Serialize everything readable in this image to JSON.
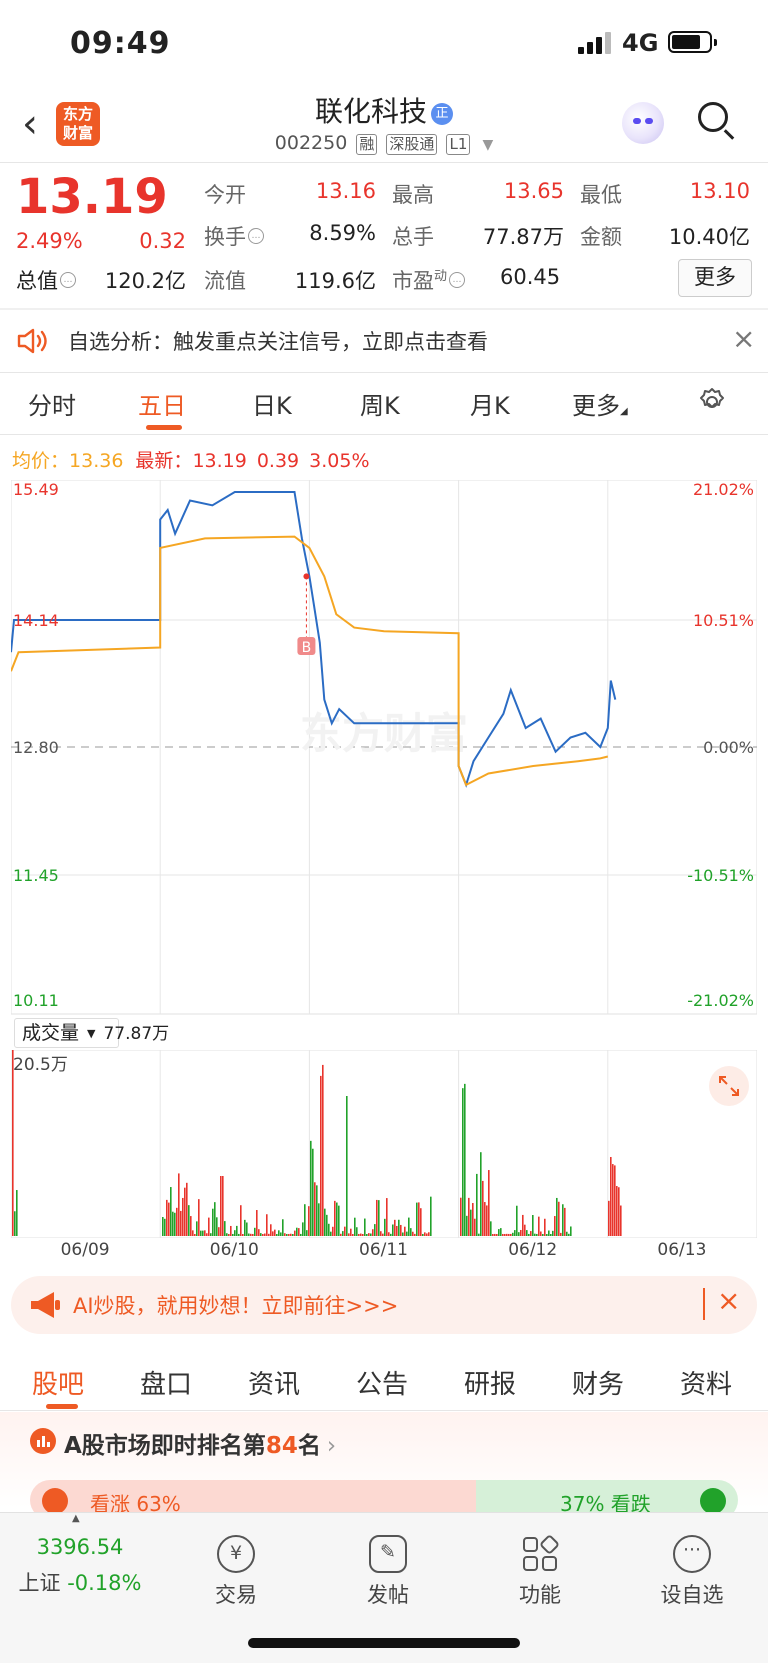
{
  "status": {
    "time": "09:49",
    "network": "4G"
  },
  "header": {
    "logo_line1": "东方",
    "logo_line2": "财富",
    "name": "联化科技",
    "badge": "正",
    "code": "002250",
    "tags": [
      "融",
      "深股通",
      "L1"
    ]
  },
  "quote": {
    "price": "13.19",
    "change_pct": "2.49%",
    "change": "0.32",
    "total_mv_label": "总值",
    "total_mv": "120.2亿",
    "fields": [
      {
        "label": "今开",
        "value": "13.16",
        "color": "#e8342c"
      },
      {
        "label": "最高",
        "value": "13.65",
        "color": "#e8342c"
      },
      {
        "label": "最低",
        "value": "13.10",
        "color": "#e8342c"
      },
      {
        "label": "换手",
        "value": "8.59%",
        "color": "#222222"
      },
      {
        "label": "总手",
        "value": "77.87万",
        "color": "#222222"
      },
      {
        "label": "金额",
        "value": "10.40亿",
        "color": "#222222"
      },
      {
        "label": "流值",
        "value": "119.6亿",
        "color": "#222222"
      },
      {
        "label": "市盈",
        "label_sup": "动",
        "value": "60.45",
        "color": "#222222"
      }
    ],
    "more": "更多"
  },
  "notice": {
    "text": "自选分析：触发重点关注信号，立即点击查看"
  },
  "tabs": [
    {
      "label": "分时",
      "active": false
    },
    {
      "label": "五日",
      "active": true
    },
    {
      "label": "日K",
      "active": false
    },
    {
      "label": "周K",
      "active": false
    },
    {
      "label": "月K",
      "active": false
    },
    {
      "label": "更多",
      "active": false
    }
  ],
  "legend": {
    "avg_label": "均价：",
    "avg_value": "13.36",
    "last_label": "最新：",
    "last_value": "13.19",
    "last_change": "0.39",
    "last_pct": "3.05%"
  },
  "chart_data": {
    "type": "line",
    "title": "",
    "x_dates": [
      "06/09",
      "06/10",
      "06/11",
      "06/12",
      "06/13"
    ],
    "y_ticks_left": [
      "15.49",
      "14.14",
      "12.80",
      "11.45",
      "10.11"
    ],
    "y_ticks_right": [
      "21.02%",
      "10.51%",
      "0.00%",
      "-10.51%",
      "-21.02%"
    ],
    "ylim": [
      10.11,
      15.49
    ],
    "prev_close": 12.8,
    "watermark": "东方财富",
    "marker": {
      "label": "B",
      "day": 1
    },
    "series": [
      {
        "color": "#2b6cc4",
        "points": [
          [
            0.0,
            13.8
          ],
          [
            0.02,
            14.14
          ],
          [
            1.0,
            14.14
          ],
          [
            1.0,
            15.2
          ],
          [
            1.05,
            15.3
          ],
          [
            1.1,
            15.05
          ],
          [
            1.2,
            15.4
          ],
          [
            1.35,
            15.35
          ],
          [
            1.5,
            15.49
          ],
          [
            1.9,
            15.49
          ],
          [
            1.95,
            15.0
          ],
          [
            2.0,
            14.6
          ],
          [
            2.03,
            14.3
          ],
          [
            2.07,
            13.9
          ],
          [
            2.1,
            13.3
          ],
          [
            2.15,
            13.05
          ],
          [
            2.2,
            13.2
          ],
          [
            2.3,
            13.05
          ],
          [
            2.5,
            13.05
          ],
          [
            2.7,
            13.05
          ],
          [
            3.0,
            13.05
          ],
          [
            3.0,
            12.6
          ],
          [
            3.05,
            12.4
          ],
          [
            3.1,
            12.65
          ],
          [
            3.2,
            12.9
          ],
          [
            3.3,
            13.15
          ],
          [
            3.35,
            13.4
          ],
          [
            3.45,
            13.0
          ],
          [
            3.55,
            13.1
          ],
          [
            3.65,
            12.75
          ],
          [
            3.75,
            12.9
          ],
          [
            3.85,
            12.95
          ],
          [
            3.95,
            12.8
          ],
          [
            4.0,
            13.0
          ],
          [
            4.02,
            13.5
          ],
          [
            4.05,
            13.3
          ]
        ]
      },
      {
        "color": "#f5a623",
        "points": [
          [
            0.0,
            13.6
          ],
          [
            0.05,
            13.8
          ],
          [
            1.0,
            13.85
          ],
          [
            1.0,
            14.9
          ],
          [
            1.3,
            15.0
          ],
          [
            1.9,
            15.02
          ],
          [
            2.0,
            14.9
          ],
          [
            2.1,
            14.6
          ],
          [
            2.18,
            14.2
          ],
          [
            2.3,
            14.06
          ],
          [
            2.5,
            14.02
          ],
          [
            3.0,
            14.0
          ],
          [
            3.0,
            12.6
          ],
          [
            3.05,
            12.4
          ],
          [
            3.2,
            12.52
          ],
          [
            3.5,
            12.6
          ],
          [
            3.8,
            12.65
          ],
          [
            3.95,
            12.68
          ],
          [
            4.0,
            12.7
          ]
        ]
      }
    ]
  },
  "volume": {
    "label": "成交量",
    "value": "77.87万",
    "max_label": "20.5万"
  },
  "ai_banner": {
    "text": "AI炒股，就用妙想！立即前往>>>"
  },
  "bottom_tabs": [
    {
      "label": "股吧",
      "active": true
    },
    {
      "label": "盘口",
      "active": false
    },
    {
      "label": "资讯",
      "active": false
    },
    {
      "label": "公告",
      "active": false
    },
    {
      "label": "研报",
      "active": false
    },
    {
      "label": "财务",
      "active": false
    },
    {
      "label": "资料",
      "active": false
    }
  ],
  "rank": {
    "prefix": "A股市场即时排名第",
    "rank": "84",
    "suffix": "名",
    "up_text": "看涨 63%",
    "down_text": "37% 看跌"
  },
  "nav": {
    "index_value": "3396.54",
    "index_name": "上证",
    "index_change": "-0.18%",
    "items": [
      {
        "label": "交易",
        "icon": "yen-icon"
      },
      {
        "label": "发帖",
        "icon": "edit-icon"
      },
      {
        "label": "功能",
        "icon": "grid-icon"
      },
      {
        "label": "设自选",
        "icon": "more-icon"
      }
    ]
  }
}
